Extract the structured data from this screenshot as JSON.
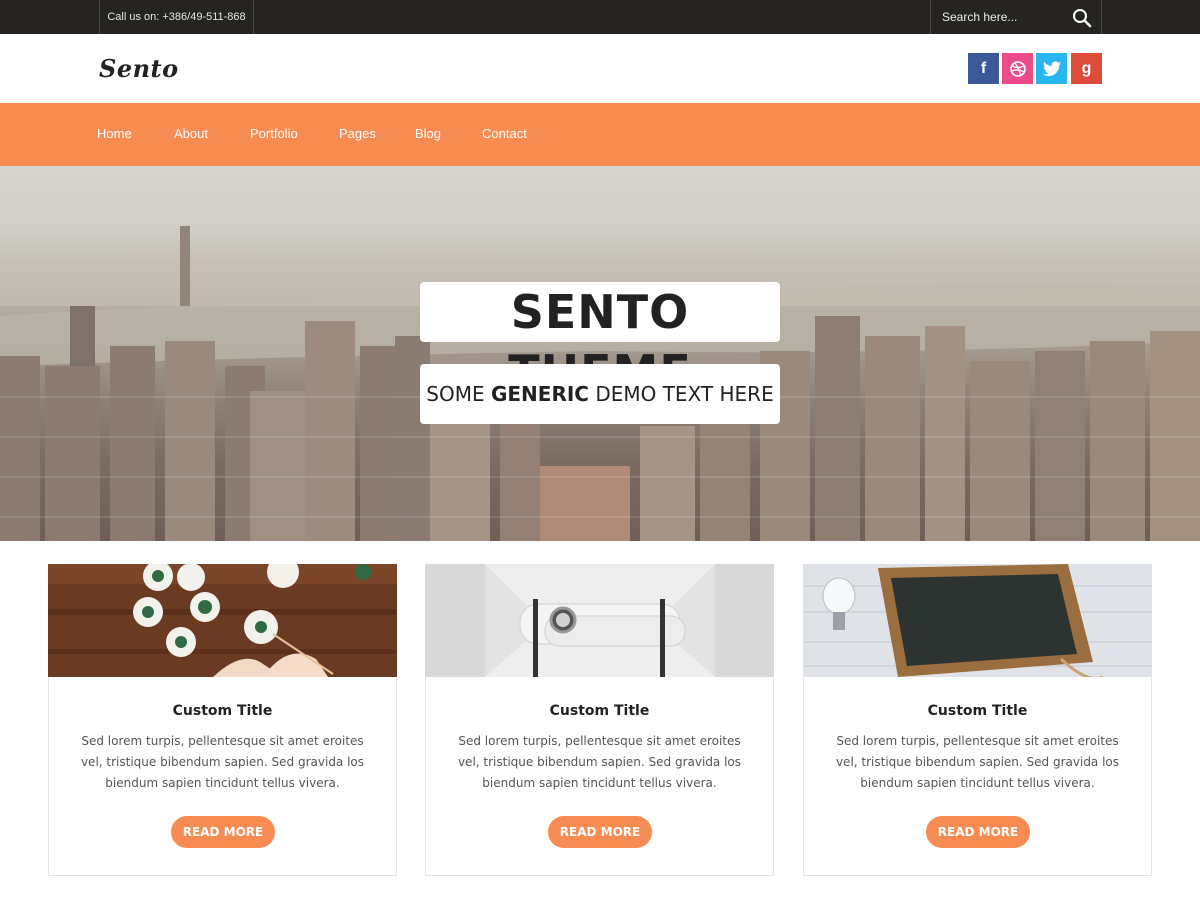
{
  "topbar": {
    "phone": "Call us on: +386/49-511-868",
    "search_placeholder": "Search here..."
  },
  "header": {
    "logo": "Sento",
    "social": [
      "facebook-icon",
      "dribbble-icon",
      "twitter-icon",
      "google-plus-icon"
    ]
  },
  "nav": {
    "items": [
      "Home",
      "About",
      "Portfolio",
      "Pages",
      "Blog",
      "Contact"
    ]
  },
  "hero": {
    "title": "SENTO THEME",
    "subtitle_pre": "SOME ",
    "subtitle_bold": "GENERIC",
    "subtitle_post": " DEMO TEXT HERE"
  },
  "cards": [
    {
      "title": "Custom Title",
      "text": "Sed lorem turpis, pellentesque sit amet eroites vel, tristique bibendum sapien. Sed gravida los biendum sapien tincidunt tellus vivera.",
      "button": "READ MORE"
    },
    {
      "title": "Custom Title",
      "text": "Sed lorem turpis, pellentesque sit amet eroites vel, tristique bibendum sapien. Sed gravida los biendum sapien tincidunt tellus vivera.",
      "button": "READ MORE"
    },
    {
      "title": "Custom Title",
      "text": "Sed lorem turpis, pellentesque sit amet eroites vel, tristique bibendum sapien. Sed gravida los biendum sapien tincidunt tellus vivera.",
      "button": "READ MORE"
    }
  ],
  "colors": {
    "topbar": "#262421",
    "accent": "#f78c52",
    "facebook": "#3b5998",
    "dribbble": "#ea4c89",
    "twitter": "#29b6f0",
    "google_plus": "#dd4b39"
  }
}
